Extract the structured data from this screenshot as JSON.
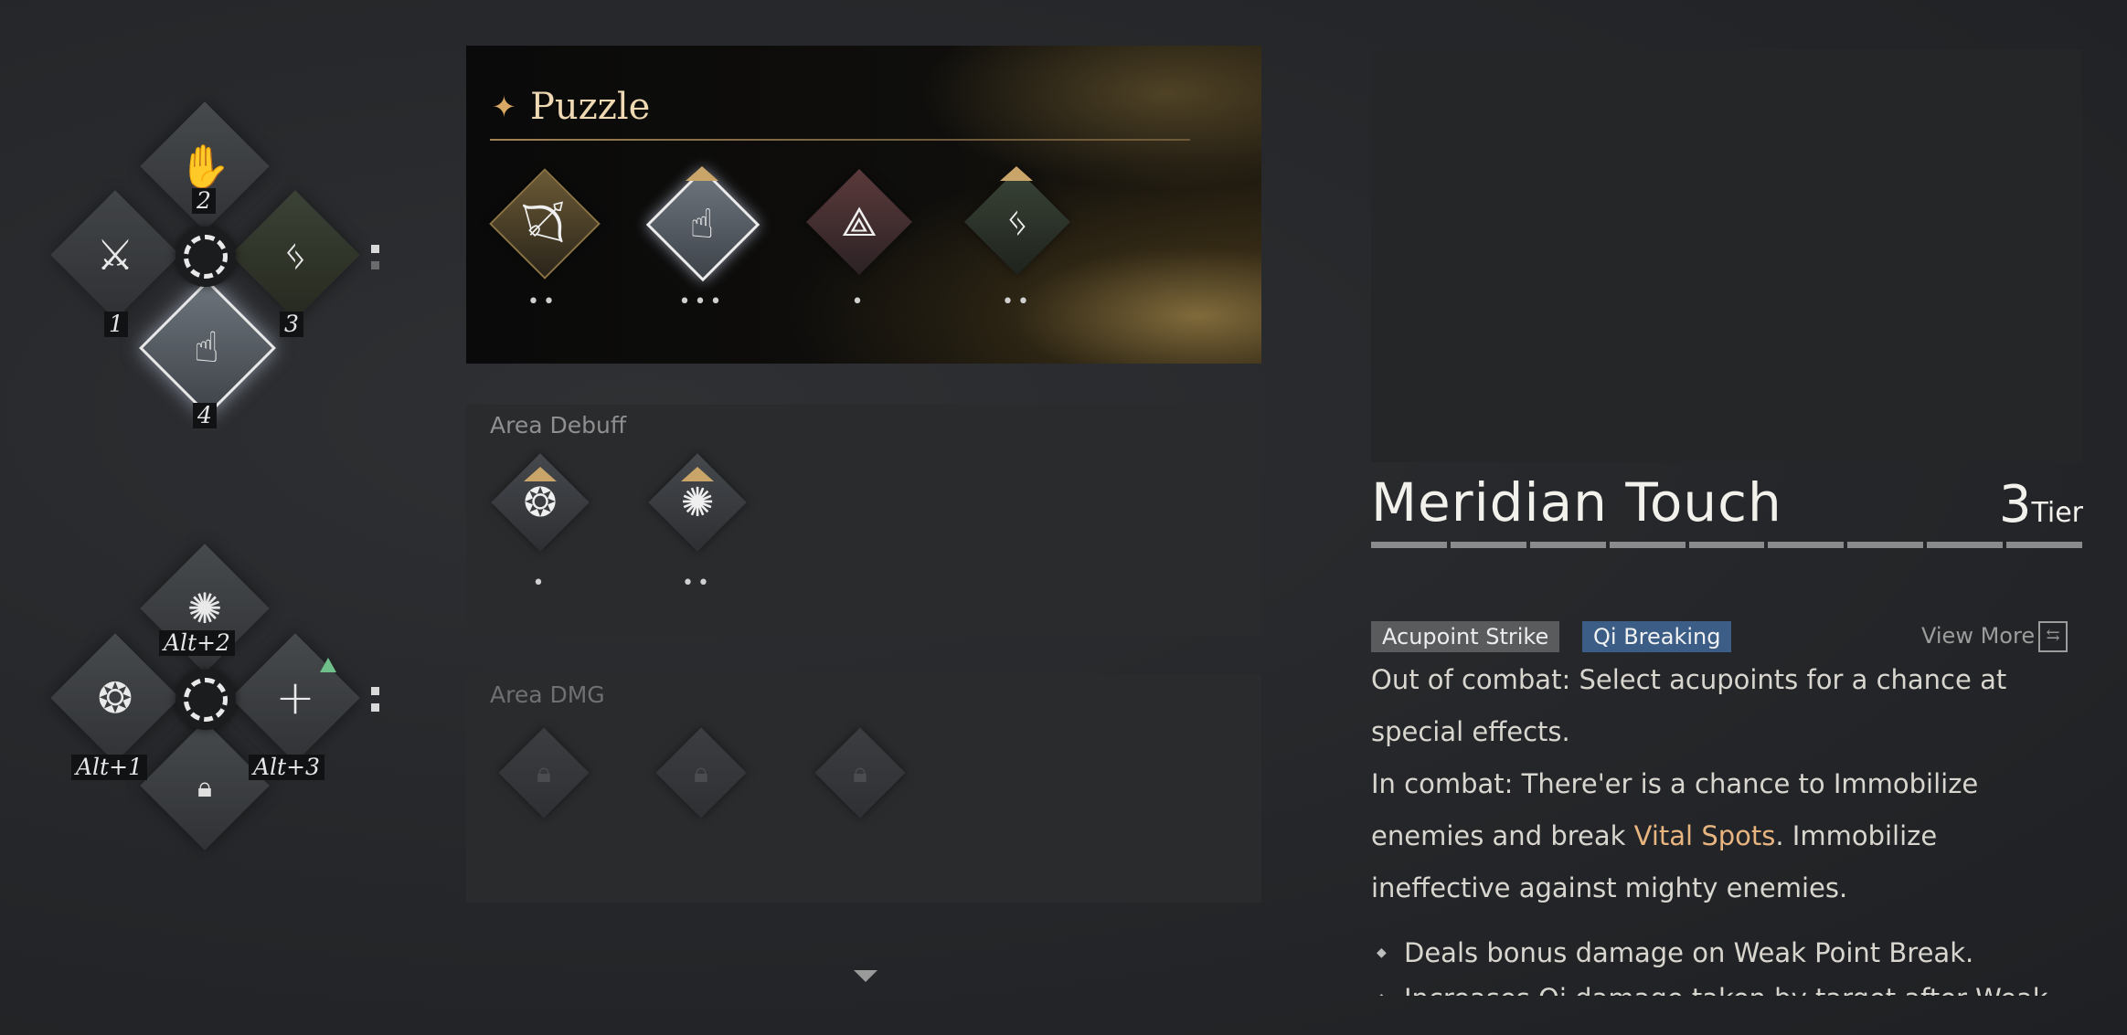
{
  "wheel_top": {
    "keys": [
      "2",
      "1",
      "3",
      "4"
    ],
    "icons": [
      "hand-pose-icon",
      "crossed-swords-icon",
      "crane-kick-icon",
      "finger-strike-icon"
    ]
  },
  "wheel_bottom": {
    "keys": [
      "Alt+2",
      "Alt+1",
      "Alt+3"
    ],
    "icons": [
      "swirl-strike-icon",
      "blade-swirl-icon",
      "add-icon",
      "lock-icon"
    ],
    "plus": "+"
  },
  "puzzle": {
    "title": "Puzzle",
    "slots": [
      {
        "icon": "archer-icon",
        "dots": "••"
      },
      {
        "icon": "finger-strike-icon",
        "dots": "•••"
      },
      {
        "icon": "wing-slash-icon",
        "dots": "•"
      },
      {
        "icon": "crane-kick-icon",
        "dots": "••"
      }
    ]
  },
  "area_debuff": {
    "title": "Area Debuff",
    "slots": [
      {
        "icon": "blade-swirl-icon",
        "dots": "•"
      },
      {
        "icon": "dragon-swirl-icon",
        "dots": "••"
      }
    ]
  },
  "area_dmg": {
    "title": "Area DMG",
    "slots": [
      "lock-icon",
      "lock-icon",
      "lock-icon"
    ]
  },
  "detail": {
    "name": "Meridian Touch",
    "tier_num": "3",
    "tier_label": "Tier",
    "tags": [
      "Acupoint Strike",
      "Qi Breaking"
    ],
    "view_more": "View More",
    "desc_line1": "Out of combat: Select acupoints for a chance at special effects.",
    "desc_line2_a": "In combat: There'er is a chance to Immobilize enemies and break ",
    "desc_highlight": "Vital Spots",
    "desc_line2_b": ". Immobilize ineffective against mighty enemies.",
    "bullets": [
      "Deals bonus damage on Weak Point Break.",
      "Increases Qi damage taken by target after Weak Point"
    ]
  }
}
